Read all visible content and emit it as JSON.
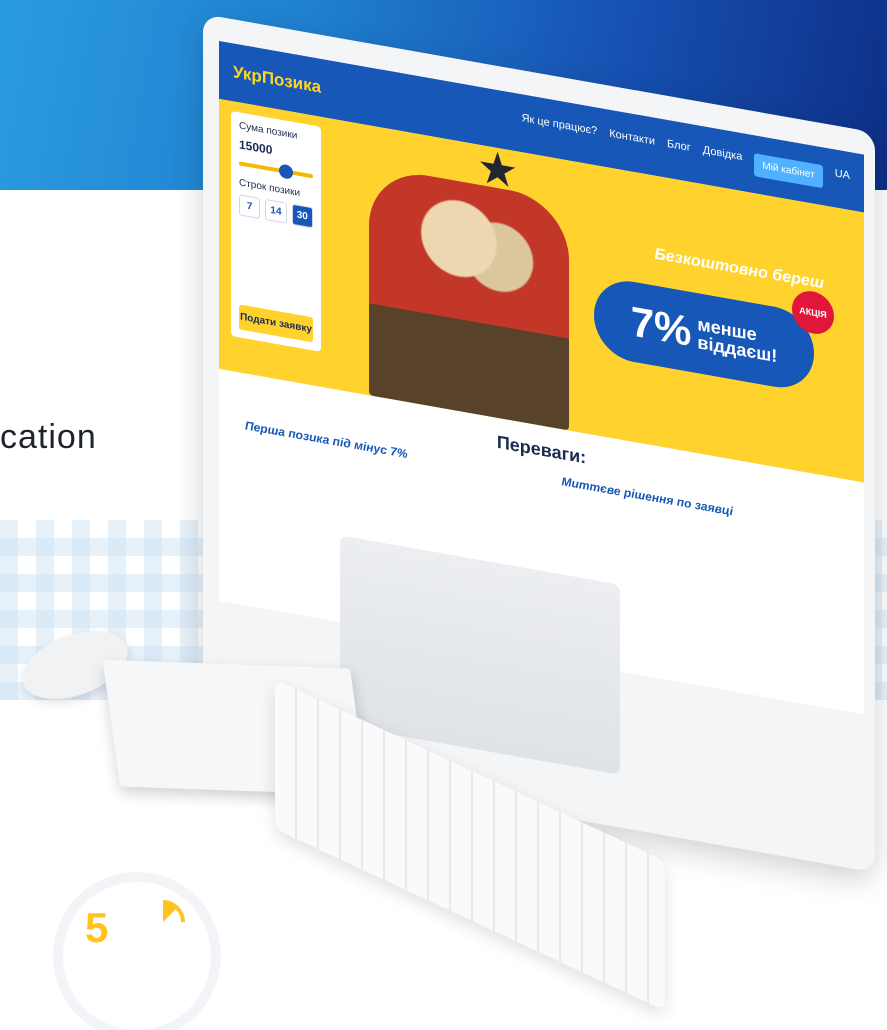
{
  "left_text": "cation",
  "site": {
    "logo": "УкрПозика",
    "nav": [
      "Як це працює?",
      "Контакти",
      "Блог",
      "Довідка"
    ],
    "nav_button": "Мій кабінет",
    "lang": "UA",
    "calc": {
      "amount_label": "Сума позики",
      "amount_value": "15000",
      "term_label": "Строк позики",
      "days": [
        "7",
        "14",
        "30"
      ],
      "apply": "Подати заявку"
    },
    "ad": {
      "line1": "Безкоштовно береш",
      "percent": "7%",
      "line2": "менше",
      "line3": "віддаєш!",
      "badge": "АКЦІЯ"
    },
    "benefits_title": "Переваги:",
    "benefits": [
      {
        "title": "Перша позика під мінус 7%"
      },
      {
        "title": "Миттєве рішення по заявці"
      }
    ]
  },
  "timer_number": "5",
  "colors": {
    "brand_blue": "#1657b8",
    "brand_yellow": "#ffd22e"
  }
}
